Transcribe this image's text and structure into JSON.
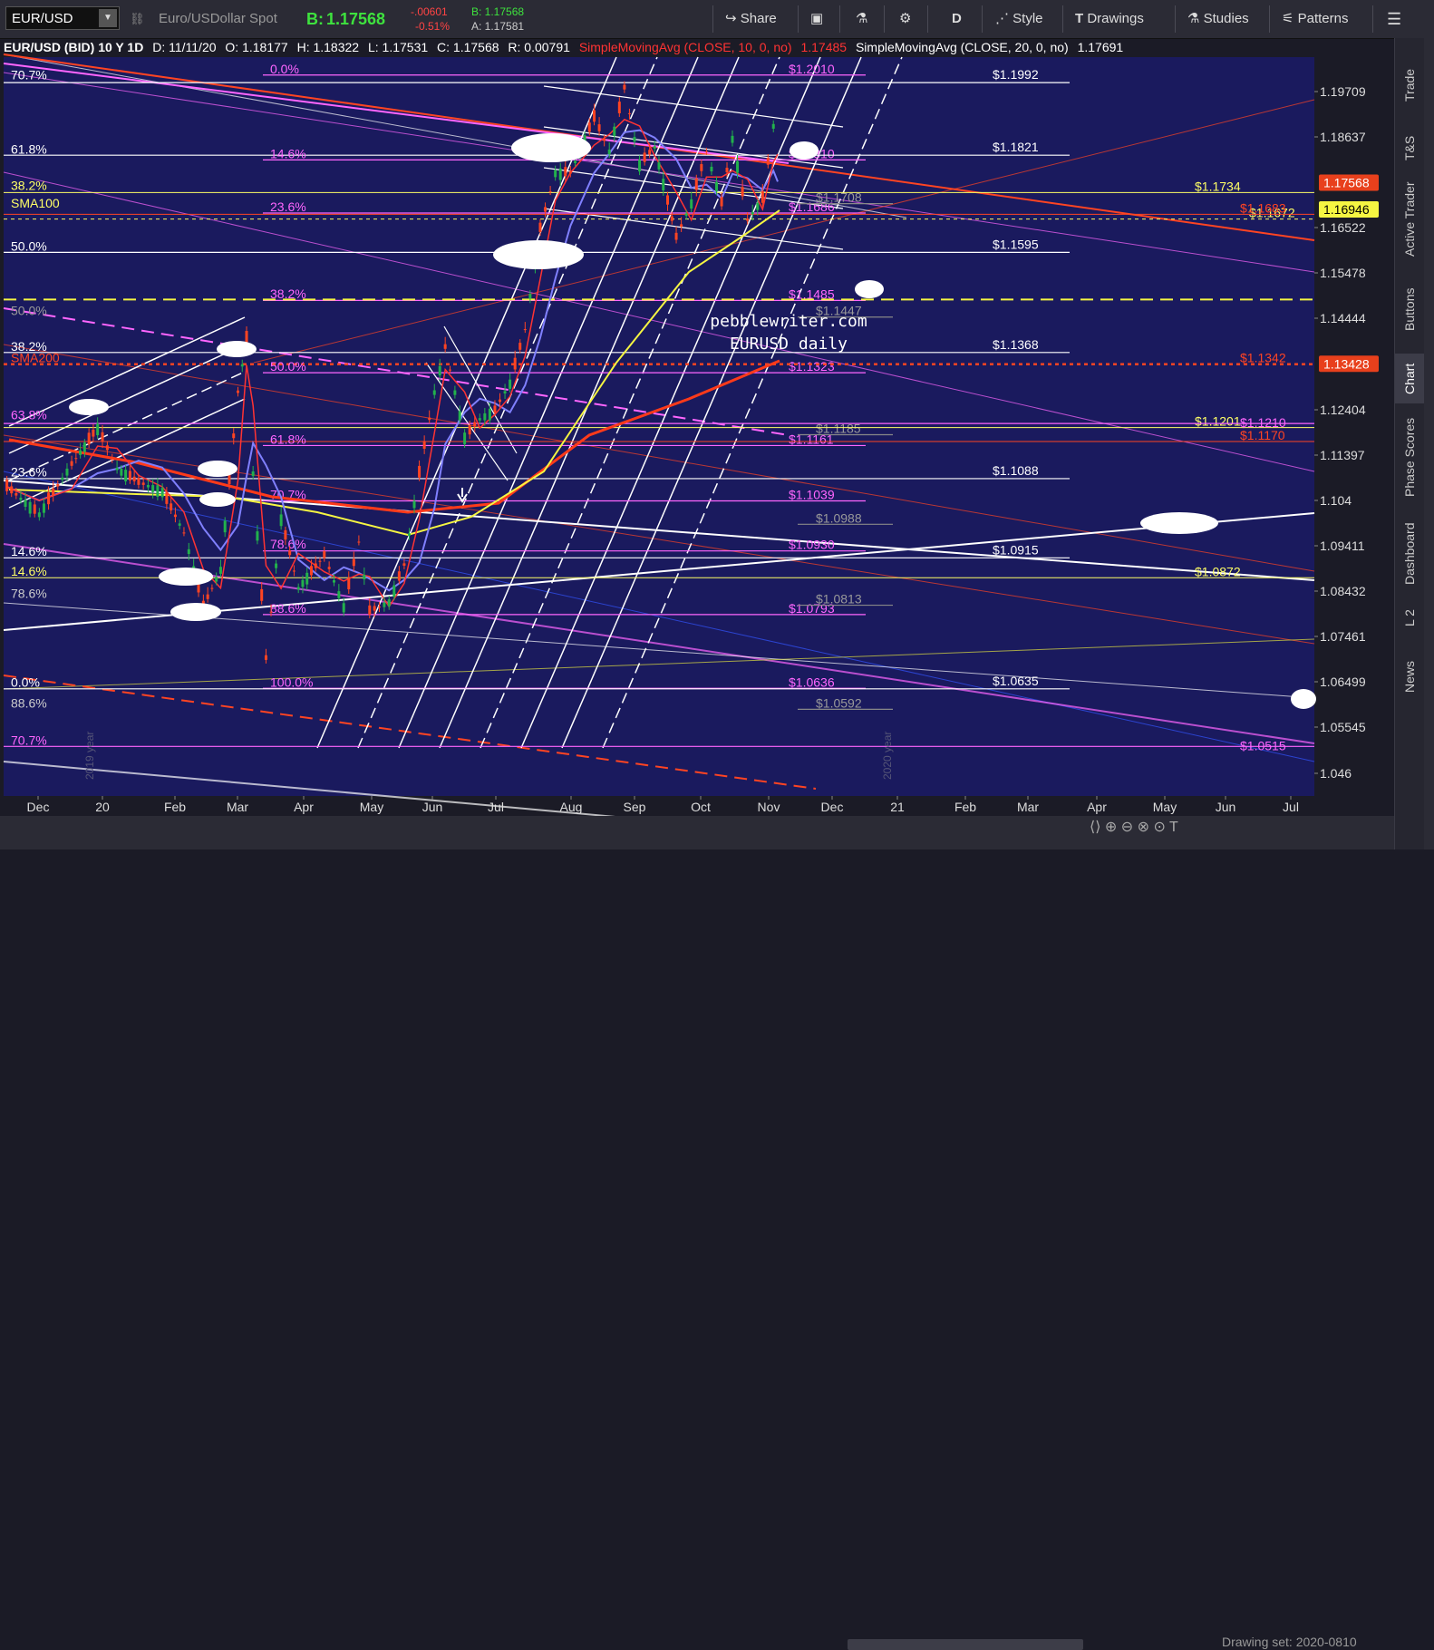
{
  "toolbar": {
    "symbol": "EUR/USD",
    "description": "Euro/USDollar Spot",
    "bid_label": "B:",
    "bid_value": "1.17568",
    "change": "-.00601",
    "change_pct": "-0.51%",
    "bid_small": "B: 1.17568",
    "ask_small": "A: 1.17581",
    "share_label": "Share",
    "period_label": "D",
    "style_label": "Style",
    "drawings_label": "Drawings",
    "studies_label": "Studies",
    "patterns_label": "Patterns"
  },
  "infobar": {
    "title": "EUR/USD (BID) 10 Y 1D",
    "date": "D: 11/11/20",
    "open": "O: 1.18177",
    "high": "H: 1.18322",
    "low": "L: 1.17531",
    "close": "C: 1.17568",
    "range": "R: 0.00791",
    "sma10": "SimpleMovingAvg (CLOSE, 10, 0, no)",
    "sma10_value": "1.17485",
    "sma20": "SimpleMovingAvg (CLOSE, 20, 0, no)",
    "sma20_value": "1.17691"
  },
  "sidebar": {
    "tabs": [
      "Trade",
      "T&S",
      "Active Trader",
      "Buttons",
      "Chart",
      "Phase Scores",
      "Dashboard",
      "L 2",
      "News"
    ],
    "active": "Chart"
  },
  "bottom": {
    "drawing_set": "Drawing set: 2020-0810"
  },
  "colors": {
    "plot_bg": "#1a1a5e",
    "up_candle": "#22b14c",
    "down_candle": "#ff4422",
    "fib_pink": "#ff66ff",
    "fib_white": "#ffffff",
    "sma100": "#f5f542",
    "sma200": "#ff3a1a",
    "sma20": "#8080ff",
    "price_tag": "#e8401c"
  },
  "chart_data": {
    "type": "candlestick",
    "title": "EUR/USD (BID) 10 Y 1D",
    "watermark": [
      "pebblewriter.com",
      "EURUSD daily"
    ],
    "y_axis_ticks": [
      "1.19709",
      "1.18637",
      "1.16522",
      "1.15478",
      "1.14444",
      "1.12404",
      "1.11397",
      "1.104",
      "1.09411",
      "1.08432",
      "1.07461",
      "1.06499",
      "1.05545",
      "1.046"
    ],
    "x_axis_ticks": [
      "Dec",
      "20",
      "Feb",
      "Mar",
      "Apr",
      "May",
      "Jun",
      "Jul",
      "Aug",
      "Sep",
      "Oct",
      "Nov",
      "Dec",
      "21",
      "Feb",
      "Mar",
      "Apr",
      "May",
      "Jun",
      "Jul"
    ],
    "year_labels": [
      "2019 year",
      "2020 year"
    ],
    "price_tags": [
      {
        "label": "1.17568",
        "value": 1.17568,
        "color": "#e8401c",
        "text_color": "#ffffff"
      },
      {
        "label": "1.16946",
        "value": 1.16946,
        "color": "#f5f542",
        "text_color": "#000000"
      },
      {
        "label": "1.13428",
        "value": 1.13428,
        "color": "#e8401c",
        "text_color": "#ffffff"
      }
    ],
    "left_labels": [
      {
        "text": "70.7%",
        "value": 1.1996,
        "color": "#ffffff"
      },
      {
        "text": "61.8%",
        "value": 1.18205,
        "color": "#ffffff"
      },
      {
        "text": "38.2%",
        "value": 1.1736,
        "color": "#ffff66"
      },
      {
        "text": "SMA100",
        "value": 1.1694,
        "color": "#ffff66"
      },
      {
        "text": "50.0%",
        "value": 1.1595,
        "color": "#ffffff"
      },
      {
        "text": "50.0%",
        "value": 1.1447,
        "color": "#999999"
      },
      {
        "text": "38.2%",
        "value": 1.1368,
        "color": "#ffffff"
      },
      {
        "text": "SMA200",
        "value": 1.1342,
        "color": "#ff4422"
      },
      {
        "text": "63.8%",
        "value": 1.1215,
        "color": "#ff66ff"
      },
      {
        "text": "23.6%",
        "value": 1.1089,
        "color": "#ffffff"
      },
      {
        "text": "14.6%",
        "value": 1.0916,
        "color": "#ffffff"
      },
      {
        "text": "14.6%",
        "value": 1.0873,
        "color": "#ffff66"
      },
      {
        "text": "78.6%",
        "value": 1.0825,
        "color": "#cccccc"
      },
      {
        "text": "0.0%",
        "value": 1.0636,
        "color": "#ffffff"
      },
      {
        "text": "88.6%",
        "value": 1.0592,
        "color": "#cccccc"
      },
      {
        "text": "70.7%",
        "value": 1.0515,
        "color": "#ff66ff"
      }
    ],
    "fib_labels": [
      {
        "text": "0.0%",
        "value": 1.201
      },
      {
        "text": "14.6%",
        "value": 1.181
      },
      {
        "text": "23.6%",
        "value": 1.1686
      },
      {
        "text": "38.2%",
        "value": 1.1486
      },
      {
        "text": "50.0%",
        "value": 1.1323
      },
      {
        "text": "61.8%",
        "value": 1.1161
      },
      {
        "text": "70.7%",
        "value": 1.1039
      },
      {
        "text": "78.6%",
        "value": 1.0931
      },
      {
        "text": "88.6%",
        "value": 1.0793
      },
      {
        "text": "100.0%",
        "value": 1.0636
      }
    ],
    "fib_levels_pink": [
      {
        "label": "$1.2010",
        "value": 1.201
      },
      {
        "label": "$1.1810",
        "value": 1.181
      },
      {
        "label": "$1.1686",
        "value": 1.1686
      },
      {
        "label": "$1.1485",
        "value": 1.1485
      },
      {
        "label": "$1.1323",
        "value": 1.1323
      },
      {
        "label": "$1.1161",
        "value": 1.1161
      },
      {
        "label": "$1.1039",
        "value": 1.1039
      },
      {
        "label": "$1.0930",
        "value": 1.093
      },
      {
        "label": "$1.0793",
        "value": 1.0793
      },
      {
        "label": "$1.0636",
        "value": 1.0636
      }
    ],
    "fib_levels_grey": [
      {
        "label": "$1.1708",
        "value": 1.1708
      },
      {
        "label": "$1.1447",
        "value": 1.1447
      },
      {
        "label": "$1.1185",
        "value": 1.1185
      },
      {
        "label": "$1.0988",
        "value": 1.0988
      },
      {
        "label": "$1.0813",
        "value": 1.0813
      },
      {
        "label": "$1.0592",
        "value": 1.0592
      }
    ],
    "white_levels": [
      {
        "label": "$1.1992",
        "value": 1.1992
      },
      {
        "label": "$1.1821",
        "value": 1.1821
      },
      {
        "label": "$1.1595",
        "value": 1.1595
      },
      {
        "label": "$1.1368",
        "value": 1.1368
      },
      {
        "label": "$1.1088",
        "value": 1.1088
      },
      {
        "label": "$1.0915",
        "value": 1.0915
      },
      {
        "label": "$1.0635",
        "value": 1.0635
      }
    ],
    "yellow_levels": [
      {
        "label": "$1.1734",
        "value": 1.1734
      },
      {
        "label": "$1.1672",
        "value": 1.1672
      },
      {
        "label": "$1.1201",
        "value": 1.1201
      },
      {
        "label": "$1.0872",
        "value": 1.0872
      }
    ],
    "red_levels": [
      {
        "label": "$1.1683",
        "value": 1.1683
      },
      {
        "label": "$1.1342",
        "value": 1.1342
      },
      {
        "label": "$1.1170",
        "value": 1.117
      }
    ],
    "pink_right_levels": [
      {
        "label": "$1.1210",
        "value": 1.121
      },
      {
        "label": "$1.0515",
        "value": 1.0515
      }
    ],
    "price_series": [
      [
        "2019-11-20",
        1.107
      ],
      [
        "2019-12-05",
        1.101
      ],
      [
        "2019-12-20",
        1.112
      ],
      [
        "2020-01-01",
        1.12
      ],
      [
        "2020-01-10",
        1.111
      ],
      [
        "2020-01-20",
        1.108
      ],
      [
        "2020-01-31",
        1.106
      ],
      [
        "2020-02-10",
        1.097
      ],
      [
        "2020-02-19",
        1.081
      ],
      [
        "2020-02-27",
        1.089
      ],
      [
        "2020-03-06",
        1.128
      ],
      [
        "2020-03-10",
        1.14
      ],
      [
        "2020-03-13",
        1.11
      ],
      [
        "2020-03-19",
        1.07
      ],
      [
        "2020-03-26",
        1.1
      ],
      [
        "2020-04-03",
        1.085
      ],
      [
        "2020-04-15",
        1.092
      ],
      [
        "2020-04-24",
        1.081
      ],
      [
        "2020-05-01",
        1.095
      ],
      [
        "2020-05-06",
        1.08
      ],
      [
        "2020-05-15",
        1.082
      ],
      [
        "2020-05-22",
        1.09
      ],
      [
        "2020-05-29",
        1.11
      ],
      [
        "2020-06-05",
        1.128
      ],
      [
        "2020-06-10",
        1.138
      ],
      [
        "2020-06-19",
        1.118
      ],
      [
        "2020-06-26",
        1.122
      ],
      [
        "2020-07-03",
        1.124
      ],
      [
        "2020-07-10",
        1.13
      ],
      [
        "2020-07-17",
        1.142
      ],
      [
        "2020-07-24",
        1.165
      ],
      [
        "2020-07-31",
        1.178
      ],
      [
        "2020-08-07",
        1.178
      ],
      [
        "2020-08-18",
        1.191
      ],
      [
        "2020-08-25",
        1.183
      ],
      [
        "2020-09-01",
        1.198
      ],
      [
        "2020-09-08",
        1.18
      ],
      [
        "2020-09-15",
        1.184
      ],
      [
        "2020-09-25",
        1.163
      ],
      [
        "2020-10-02",
        1.171
      ],
      [
        "2020-10-09",
        1.183
      ],
      [
        "2020-10-16",
        1.171
      ],
      [
        "2020-10-21",
        1.186
      ],
      [
        "2020-10-28",
        1.167
      ],
      [
        "2020-11-04",
        1.172
      ],
      [
        "2020-11-09",
        1.189
      ],
      [
        "2020-11-11",
        1.1757
      ]
    ]
  }
}
